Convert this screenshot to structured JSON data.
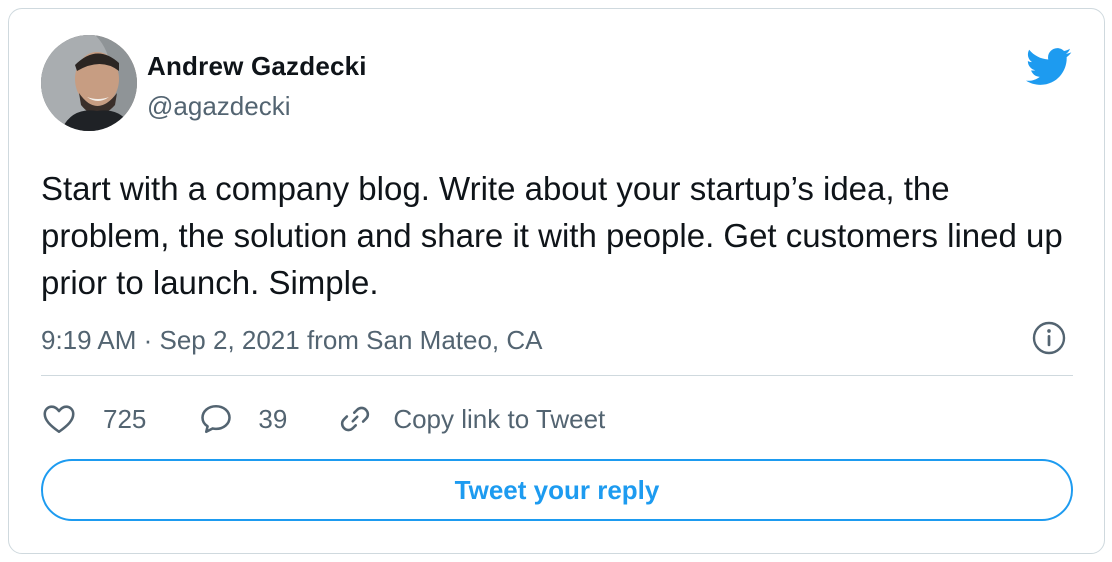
{
  "author": {
    "name": "Andrew Gazdecki",
    "handle": "@agazdecki",
    "avatar_icon": "profile-photo"
  },
  "brand": {
    "icon": "twitter-bird-icon",
    "color": "#1d9bf0"
  },
  "tweet": {
    "text": "Start with a company blog. Write about your startup’s idea, the problem, the solution and share it with people. Get customers lined up prior to launch. Simple.",
    "timestamp": "9:19 AM · Sep 2, 2021 from San Mateo, CA"
  },
  "actions": {
    "likes": "725",
    "replies": "39",
    "copy_link": "Copy link to Tweet"
  },
  "reply_button": "Tweet your reply",
  "colors": {
    "text": "#0f1419",
    "secondary": "#536471",
    "border": "#cfd9de",
    "accent": "#1d9bf0"
  }
}
